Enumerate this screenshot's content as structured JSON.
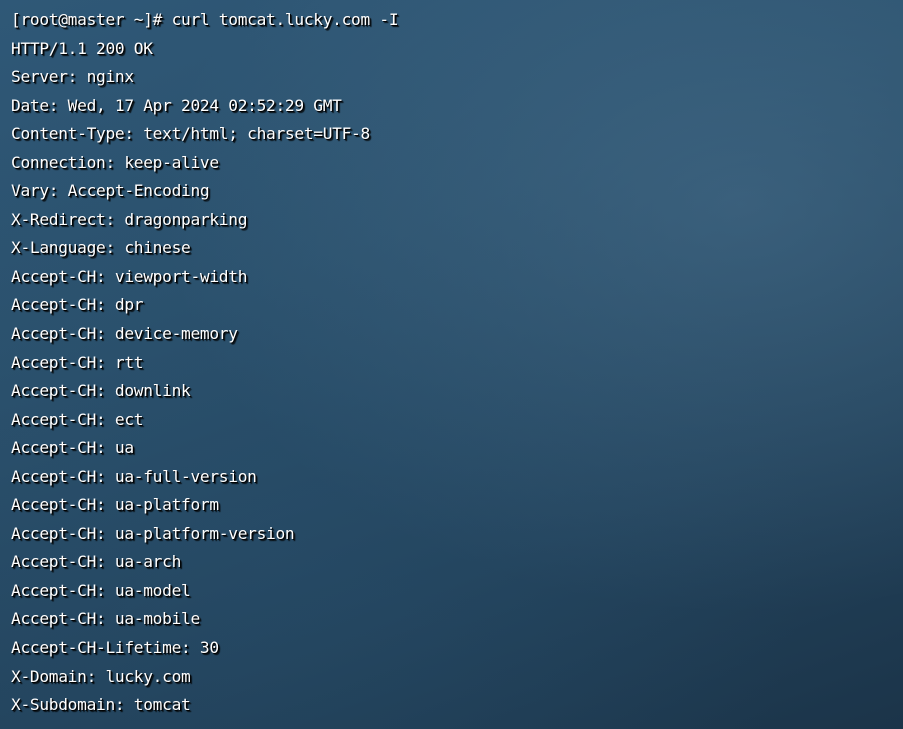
{
  "terminal": {
    "lines": [
      "[root@master ~]# curl tomcat.lucky.com -I",
      "HTTP/1.1 200 OK",
      "Server: nginx",
      "Date: Wed, 17 Apr 2024 02:52:29 GMT",
      "Content-Type: text/html; charset=UTF-8",
      "Connection: keep-alive",
      "Vary: Accept-Encoding",
      "X-Redirect: dragonparking",
      "X-Language: chinese",
      "Accept-CH: viewport-width",
      "Accept-CH: dpr",
      "Accept-CH: device-memory",
      "Accept-CH: rtt",
      "Accept-CH: downlink",
      "Accept-CH: ect",
      "Accept-CH: ua",
      "Accept-CH: ua-full-version",
      "Accept-CH: ua-platform",
      "Accept-CH: ua-platform-version",
      "Accept-CH: ua-arch",
      "Accept-CH: ua-model",
      "Accept-CH: ua-mobile",
      "Accept-CH-Lifetime: 30",
      "X-Domain: lucky.com",
      "X-Subdomain: tomcat"
    ]
  }
}
